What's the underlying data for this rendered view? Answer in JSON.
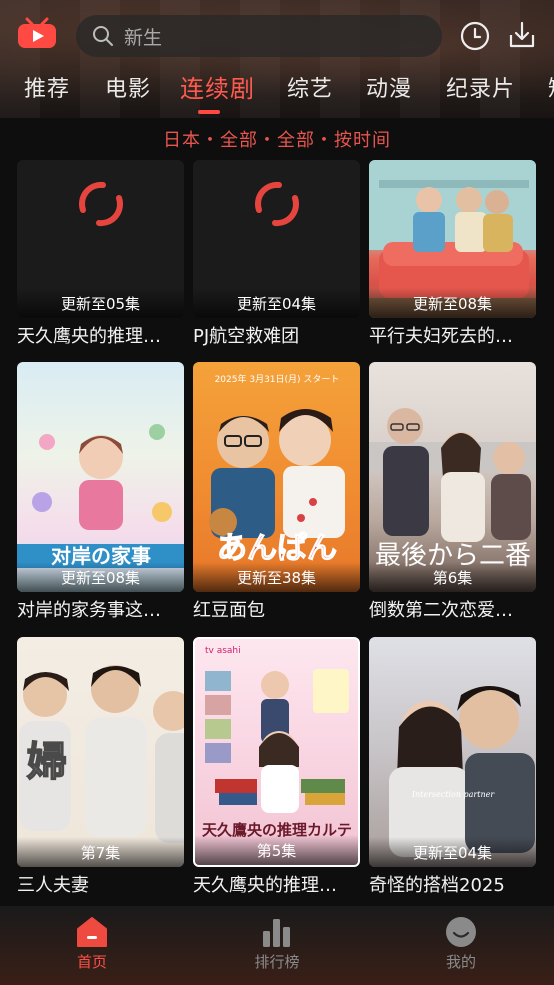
{
  "search": {
    "placeholder": "新生"
  },
  "tabs": [
    {
      "label": "推荐"
    },
    {
      "label": "电影"
    },
    {
      "label": "连续剧"
    },
    {
      "label": "综艺"
    },
    {
      "label": "动漫"
    },
    {
      "label": "纪录片"
    },
    {
      "label": "短"
    }
  ],
  "active_tab": "连续剧",
  "filter": {
    "text": "日本・全部・全部・按时间"
  },
  "cards": [
    {
      "title": "天久鹰央的推理…",
      "badge": "更新至05集"
    },
    {
      "title": "PJ航空救难团",
      "badge": "更新至04集"
    },
    {
      "title": "平行夫妇死去的…",
      "badge": "更新至08集"
    },
    {
      "title": "对岸的家务事这…",
      "badge": "更新至08集"
    },
    {
      "title": "红豆面包",
      "badge": "更新至38集"
    },
    {
      "title": "倒数第二次恋爱…",
      "badge": "第6集"
    },
    {
      "title": "三人夫妻",
      "badge": "第7集"
    },
    {
      "title": "天久鹰央的推理…",
      "badge": "第5集"
    },
    {
      "title": "奇怪的搭档2025",
      "badge": "更新至04集"
    }
  ],
  "posters": {
    "c4_text": "对岸の家事",
    "c5_text": "あんぱん",
    "c5_top": "2025年 3月31日(月) スタート",
    "c6_text": "最後から二番",
    "c7_text": "婦",
    "c8_text": "天久鷹央の推理カルテ",
    "c8_brand": "tv asahi",
    "c9_text": "Intersection partner"
  },
  "bottom_nav": [
    {
      "label": "首页",
      "icon": "home-icon"
    },
    {
      "label": "排行榜",
      "icon": "ranking-icon"
    },
    {
      "label": "我的",
      "icon": "profile-icon"
    }
  ],
  "colors": {
    "accent": "#ff4a44",
    "filter": "#e8554e",
    "inactive": "#8a8a8a"
  }
}
